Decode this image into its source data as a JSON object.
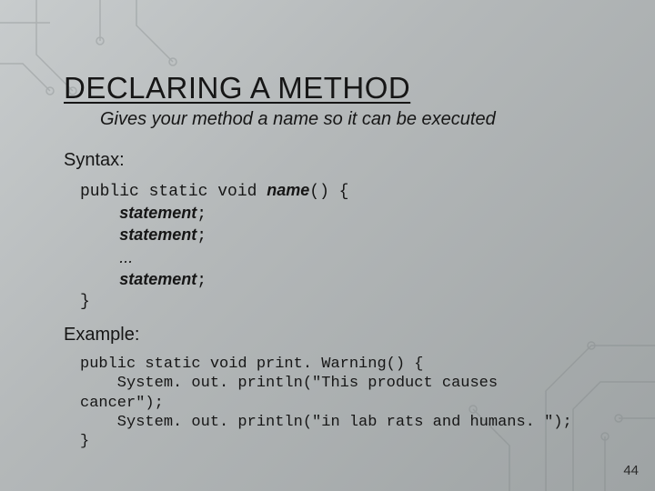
{
  "title": "DECLARING A METHOD",
  "subtitle": "Gives your method a name so it can be executed",
  "syntax_label": "Syntax:",
  "syntax": {
    "sig_prefix": "public static void ",
    "sig_name": "name",
    "sig_suffix": "() {",
    "stmt": "statement",
    "semi": ";",
    "dots": "...",
    "close": "}"
  },
  "example_label": "Example:",
  "example": {
    "line1": "public static void print. Warning() {",
    "line2": "    System. out. println(\"This product causes",
    "line3": "cancer\");",
    "line4": "    System. out. println(\"in lab rats and humans. \");",
    "line5": "}"
  },
  "page_number": "44"
}
